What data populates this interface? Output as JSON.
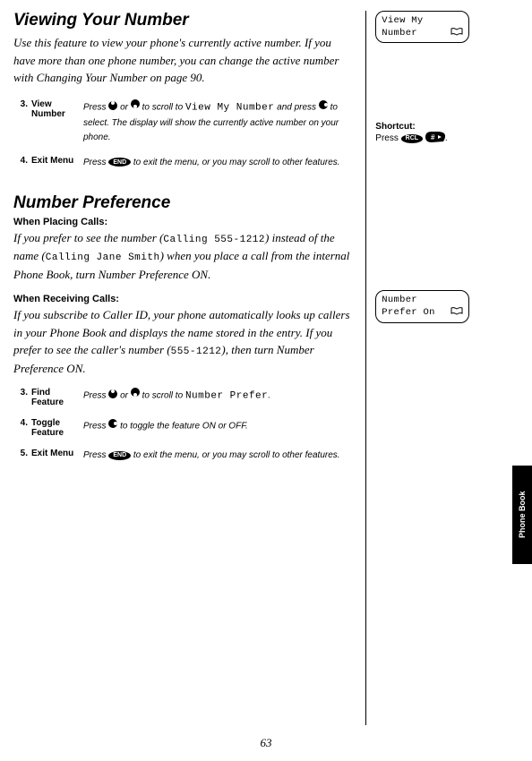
{
  "section1": {
    "heading": "Viewing Your Number",
    "intro": "Use this feature to view your phone's currently active number. If you have more than one phone number, you can change the active number with Changing Your Number on page 90.",
    "steps": [
      {
        "num": "3.",
        "name": "View Number",
        "desc_pre": "Press ",
        "desc_mid1": " or ",
        "desc_mid2": " to scroll to ",
        "lcd": "View My Number",
        "desc_mid3": " and press ",
        "desc_post": " to select. The display will show the currently active number on your phone."
      },
      {
        "num": "4.",
        "name": "Exit Menu",
        "desc_pre": "Press ",
        "end_label": "END",
        "desc_post": " to exit the menu, or you may scroll to other features."
      }
    ],
    "screen": {
      "line1": "View My",
      "line2": "Number"
    },
    "shortcut": {
      "label": "Shortcut:",
      "pre": "Press ",
      "key1": "RCL",
      "post": "."
    }
  },
  "section2": {
    "heading": "Number Preference",
    "sub1": {
      "title": "When Placing Calls:",
      "pre": "If you prefer to see the number (",
      "lcd1": "Calling 555-1212",
      "mid": ") instead of the name (",
      "lcd2": "Calling Jane Smith",
      "post": ") when you place a call from the internal Phone Book, turn Number Preference ON."
    },
    "sub2": {
      "title": "When Receiving Calls:",
      "pre": "If you subscribe to Caller ID, your phone automatically looks up callers in your Phone Book and displays the name stored in the entry. If you prefer to see the caller's number (",
      "lcd": "555-1212",
      "post": "), then turn Number Preference ON."
    },
    "steps": [
      {
        "num": "3.",
        "name": "Find Feature",
        "desc_pre": "Press ",
        "desc_mid": " or ",
        "desc_mid2": " to scroll to ",
        "lcd": "Number Prefer",
        "desc_post": "."
      },
      {
        "num": "4.",
        "name": "Toggle Feature",
        "desc_pre": "Press ",
        "desc_post": " to toggle the feature ON or OFF."
      },
      {
        "num": "5.",
        "name": "Exit Menu",
        "desc_pre": "Press ",
        "end_label": "END",
        "desc_post": " to exit the menu, or you may scroll to other features."
      }
    ],
    "screen": {
      "line1": "Number",
      "line2": "Prefer On"
    }
  },
  "tab": "Phone Book",
  "page_num": "63"
}
